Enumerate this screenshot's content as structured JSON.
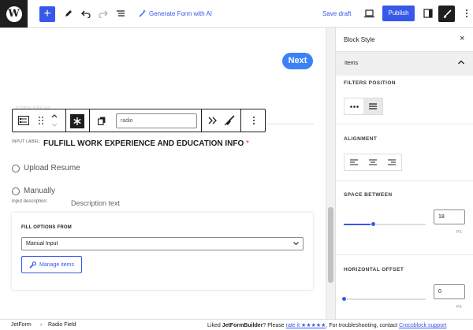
{
  "topbar": {
    "generate_form_label": "Generate Form with AI",
    "save_draft_label": "Save draft",
    "publish_label": "Publish"
  },
  "canvas": {
    "next_label": "Next",
    "faint_label": "FORM BREAK",
    "block_toolbar": {
      "input_value": "radio"
    },
    "input_label_small": "INPUT LABEL:",
    "field_title": "FULFILL WORK EXPERIENCE AND EDUCATION INFO",
    "required_mark": "*",
    "options": [
      "Upload Resume",
      "Manually"
    ],
    "input_description_label": "input description:",
    "description_text": "Description text",
    "fill_options": {
      "title": "FILL OPTIONS FROM",
      "selected": "Manual Input",
      "manage_label": "Manage items"
    }
  },
  "sidebar": {
    "title": "Block Style",
    "section_label": "Items",
    "filters_position_label": "FILTERS POSITION",
    "alignment_label": "ALIGNMENT",
    "space_between_label": "SPACE BETWEEN",
    "space_between_value": "18",
    "space_between_unit": "PX",
    "space_between_fraction": 0.36,
    "horizontal_offset_label": "HORIZONTAL OFFSET",
    "horizontal_offset_value": "0",
    "horizontal_offset_unit": "PX",
    "horizontal_offset_fraction": 0.0
  },
  "footer": {
    "breadcrumb": [
      "JetForm",
      "Radio Field"
    ],
    "liked_prefix": "Liked ",
    "brand": "JetFormBuilder",
    "liked_middle": "? Please ",
    "rate_link": "rate it ★★★★★",
    "liked_suffix": ". For troubleshooting, contact ",
    "support_link": "Crocoblock support"
  },
  "colors": {
    "accent": "#3858e9",
    "next_button": "#3b82f6",
    "required": "#d63638",
    "dark": "#1e1e1e"
  }
}
